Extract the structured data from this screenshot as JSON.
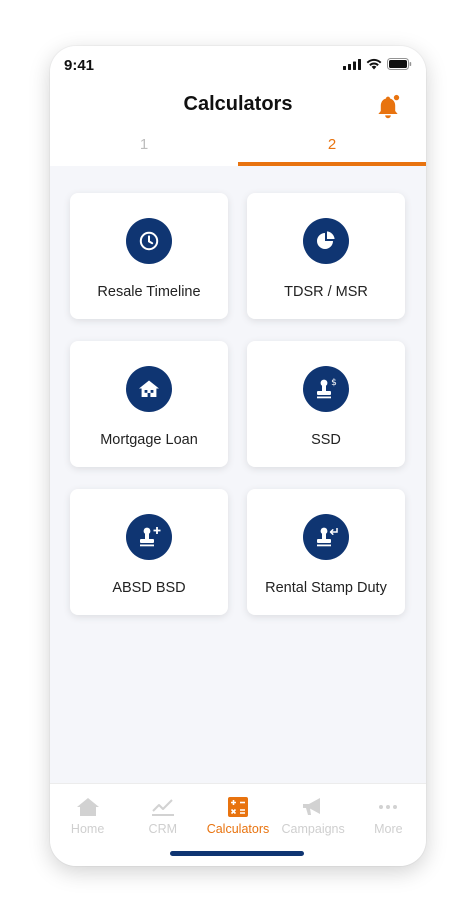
{
  "status_bar": {
    "time": "9:41"
  },
  "header": {
    "title": "Calculators"
  },
  "tabs": [
    {
      "label": "1",
      "active": false
    },
    {
      "label": "2",
      "active": true
    }
  ],
  "calculators": [
    {
      "label": "Resale Timeline",
      "icon": "clock-icon"
    },
    {
      "label": "TDSR / MSR",
      "icon": "pie-chart-icon"
    },
    {
      "label": "Mortgage Loan",
      "icon": "house-icon"
    },
    {
      "label": "SSD",
      "icon": "stamp-dollar-icon"
    },
    {
      "label": "ABSD BSD",
      "icon": "stamp-plus-icon"
    },
    {
      "label": "Rental Stamp Duty",
      "icon": "stamp-return-icon"
    }
  ],
  "bottom_nav": [
    {
      "label": "Home",
      "icon": "home-icon",
      "active": false
    },
    {
      "label": "CRM",
      "icon": "chart-line-icon",
      "active": false
    },
    {
      "label": "Calculators",
      "icon": "calculator-icon",
      "active": true
    },
    {
      "label": "Campaigns",
      "icon": "megaphone-icon",
      "active": false
    },
    {
      "label": "More",
      "icon": "more-dots-icon",
      "active": false
    }
  ],
  "colors": {
    "accent": "#e8730f",
    "primary": "#0f3572",
    "background": "#f5f6fa"
  }
}
